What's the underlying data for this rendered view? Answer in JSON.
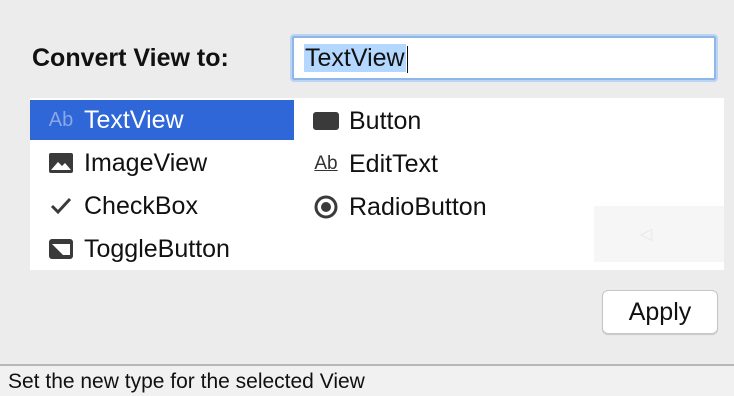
{
  "dialog": {
    "title": "Convert View to:",
    "input": {
      "selected_text": "TextView"
    }
  },
  "types": [
    {
      "label": "TextView",
      "icon": "textview-icon",
      "glyph": "Ab",
      "selected": true
    },
    {
      "label": "ImageView",
      "icon": "image-icon"
    },
    {
      "label": "CheckBox",
      "icon": "checkmark-icon"
    },
    {
      "label": "ToggleButton",
      "icon": "toggle-icon"
    },
    {
      "label": "Button",
      "icon": "button-icon"
    },
    {
      "label": "EditText",
      "icon": "edittext-icon",
      "glyph": "Ab"
    },
    {
      "label": "RadioButton",
      "icon": "radio-icon"
    }
  ],
  "apply_label": "Apply",
  "status": "Set the new type for the selected View",
  "colors": {
    "selection": "#2f67d8",
    "input_highlight": "#b3d7ff",
    "background": "#ececec"
  }
}
